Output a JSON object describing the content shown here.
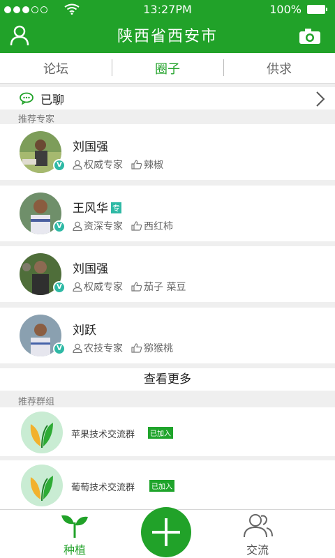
{
  "status": {
    "time": "13:27PM",
    "battery": "100%"
  },
  "header": {
    "title": "陕西省西安市"
  },
  "tabs": [
    {
      "label": "论坛",
      "active": false
    },
    {
      "label": "圈子",
      "active": true
    },
    {
      "label": "供求",
      "active": false
    }
  ],
  "chatted": {
    "label": "已聊"
  },
  "experts_section": {
    "label": "推荐专家"
  },
  "experts": [
    {
      "name": "刘国强",
      "title": "权威专家",
      "crops": "辣椒",
      "zhuan": ""
    },
    {
      "name": "王风华",
      "title": "资深专家",
      "crops": "西红柿",
      "zhuan": "专"
    },
    {
      "name": "刘国强",
      "title": "权威专家",
      "crops": "茄子 菜豆",
      "zhuan": ""
    },
    {
      "name": "刘跃",
      "title": "农技专家",
      "crops": "猕猴桃",
      "zhuan": ""
    }
  ],
  "more": {
    "label": "查看更多"
  },
  "groups_section": {
    "label": "推荐群组"
  },
  "groups": [
    {
      "name": "苹果技术交流群",
      "badge": "已加入"
    },
    {
      "name": "葡萄技术交流群",
      "badge": "已加入"
    }
  ],
  "bottom_nav": {
    "plant": "种植",
    "communicate": "交流"
  },
  "colors": {
    "primary": "#21a229",
    "teal": "#2eb9a5"
  }
}
